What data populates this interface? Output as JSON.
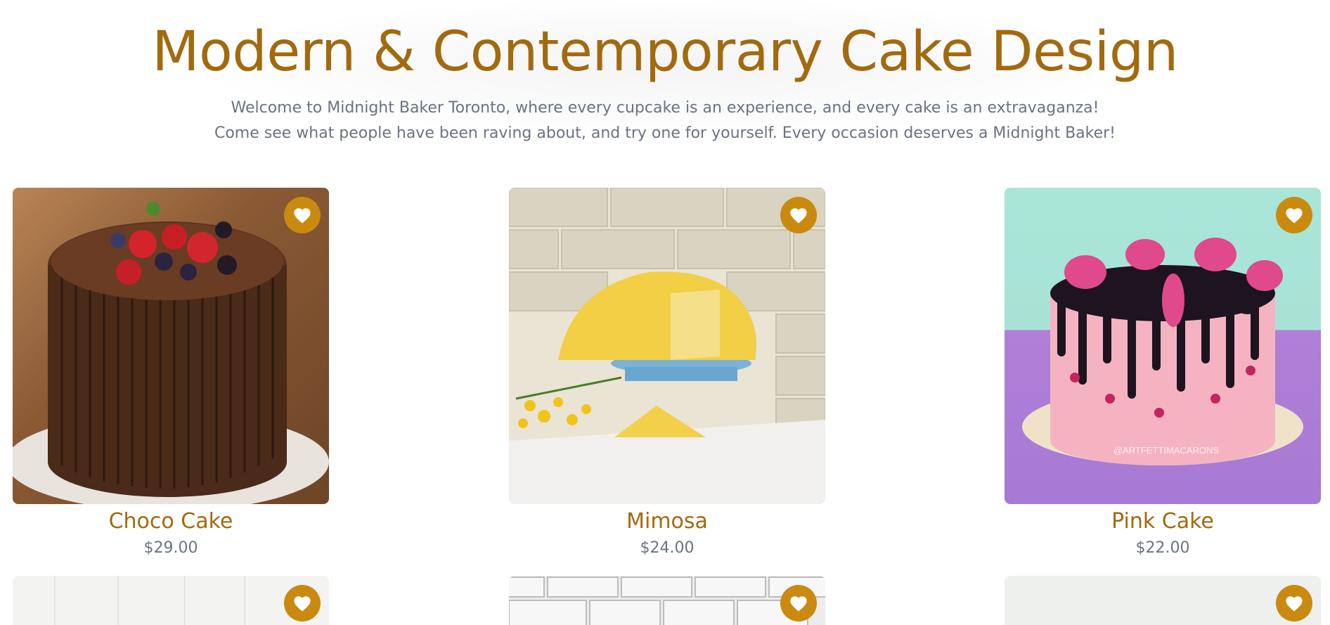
{
  "hero": {
    "title": "Modern & Contemporary Cake Design",
    "line1": "Welcome to Midnight Baker Toronto, where every cupcake is an experience, and every cake is an extravaganza!",
    "line2": "Come see what people have been raving about, and try one for yourself. Every occasion deserves a Midnight Baker!"
  },
  "products": [
    {
      "name": "Choco Cake",
      "price": "$29.00",
      "favorite_icon": "heart-icon"
    },
    {
      "name": "Mimosa",
      "price": "$24.00",
      "favorite_icon": "heart-icon"
    },
    {
      "name": "Pink Cake",
      "price": "$22.00",
      "favorite_icon": "heart-icon"
    }
  ],
  "images": {
    "pink_cake_watermark": "@ARTFETTIMACARONS"
  },
  "colors": {
    "accent": "#a26a0f",
    "favorite_button": "#c98a0f",
    "muted_text": "#6b7380"
  }
}
